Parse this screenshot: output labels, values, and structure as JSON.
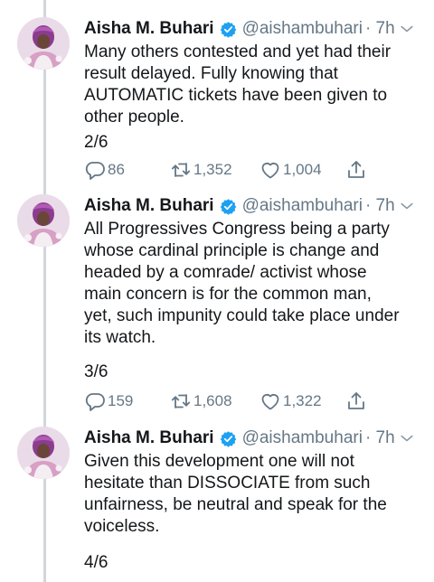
{
  "tweets": [
    {
      "name": "Aisha M. Buhari",
      "handle": "@aishambuhari",
      "time": "· 7h",
      "lines": [
        "Many others contested and yet had their",
        "result delayed. Fully knowing that",
        "AUTOMATIC tickets have been given to",
        "other people."
      ],
      "count": "2/6",
      "replies": "86",
      "retweets": "1,352",
      "likes": "1,004"
    },
    {
      "name": "Aisha M. Buhari",
      "handle": "@aishambuhari",
      "time": "· 7h",
      "lines": [
        "All Progressives Congress being a party",
        "whose cardinal principle is change and",
        "headed by a comrade/ activist whose",
        "main concern is for the common man,",
        "yet, such impunity could take place under",
        "its watch."
      ],
      "count": "3/6",
      "replies": "159",
      "retweets": "1,608",
      "likes": "1,322"
    },
    {
      "name": "Aisha M. Buhari",
      "handle": "@aishambuhari",
      "time": "· 7h",
      "lines": [
        "Given this development one will not",
        "hesitate than DISSOCIATE from such",
        "unfairness, be neutral and speak for the",
        "voiceless."
      ],
      "count": "4/6"
    }
  ],
  "colors": {
    "text": "#14171a",
    "muted": "#657786",
    "verified": "#1da1f2",
    "thread_line": "#cfd6dc"
  },
  "icons": {
    "verified": "verified-badge-icon",
    "more": "chevron-down-icon",
    "reply": "reply-icon",
    "retweet": "retweet-icon",
    "like": "heart-icon",
    "share": "share-icon"
  }
}
